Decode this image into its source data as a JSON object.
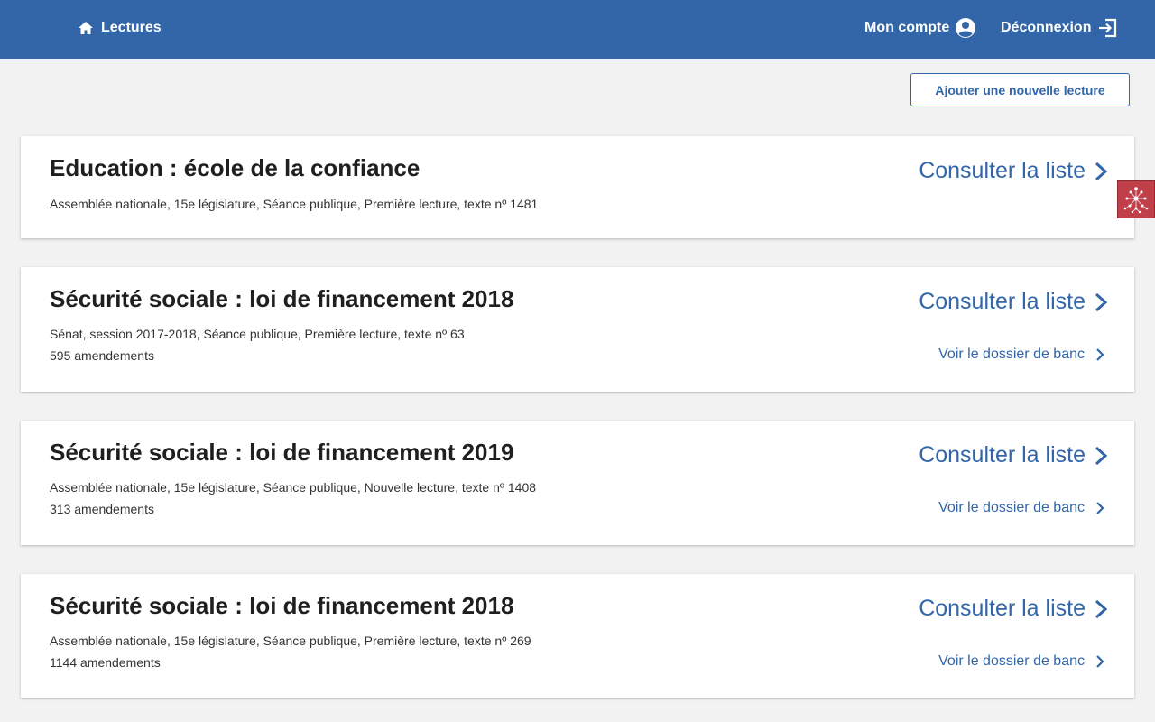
{
  "nav": {
    "home_label": "Lectures",
    "account_label": "Mon compte",
    "logout_label": "Déconnexion"
  },
  "actions": {
    "add_label": "Ajouter une nouvelle lecture"
  },
  "lectures": [
    {
      "title": "Education : école de la confiance",
      "meta": "Assemblée nationale, 15e législature, Séance publique, Première lecture, texte nº 1481",
      "amendments": "",
      "consult_label": "Consulter la liste",
      "banc_label": ""
    },
    {
      "title": "Sécurité sociale : loi de financement 2018",
      "meta": "Sénat, session 2017-2018, Séance publique, Première lecture, texte nº 63",
      "amendments": "595 amendements",
      "consult_label": "Consulter la liste",
      "banc_label": "Voir le dossier de banc"
    },
    {
      "title": "Sécurité sociale : loi de financement 2019",
      "meta": "Assemblée nationale, 15e législature, Séance publique, Nouvelle lecture, texte nº 1408",
      "amendments": "313 amendements",
      "consult_label": "Consulter la liste",
      "banc_label": "Voir le dossier de banc"
    },
    {
      "title": "Sécurité sociale : loi de financement 2018",
      "meta": "Assemblée nationale, 15e législature, Séance publique, Première lecture, texte nº 269",
      "amendments": "1144 amendements",
      "consult_label": "Consulter la liste",
      "banc_label": "Voir le dossier de banc"
    }
  ],
  "icons": {
    "home": "home-icon",
    "account": "account-circle-icon",
    "logout": "logout-icon",
    "chevron": "chevron-right-icon",
    "widget": "network-graph-icon"
  },
  "colors": {
    "header_bg": "#3366a8",
    "accent": "#3366a8",
    "page_bg": "#f2f2f2",
    "widget_bg": "#c0404a"
  }
}
